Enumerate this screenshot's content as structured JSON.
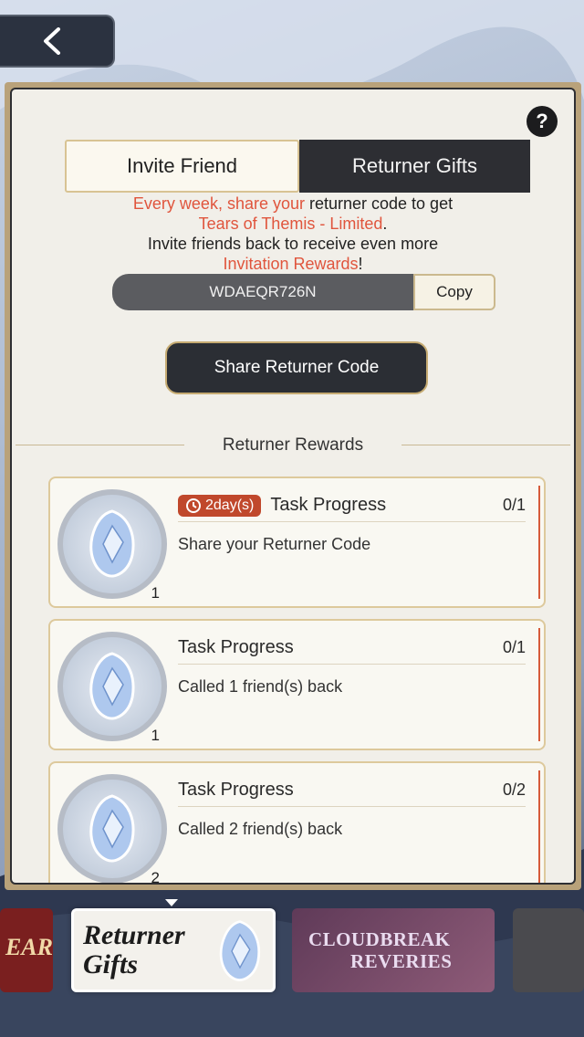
{
  "nav": {
    "back_icon": "chevron-left-icon"
  },
  "help": {
    "label": "?"
  },
  "tabs": [
    {
      "label": "Invite Friend",
      "active": true
    },
    {
      "label": "Returner Gifts",
      "active": false
    }
  ],
  "intro": {
    "line1_a": "Every week, share your",
    "line1_b": " returner code to get",
    "line2_a": "Tears of Themis - Limited",
    "line2_b": ".",
    "line3": "Invite friends back to receive even more",
    "line4_a": "Invitation Rewards",
    "line4_b": "!"
  },
  "code": {
    "value": "WDAEQR726N",
    "copy_label": "Copy"
  },
  "share_button": "Share Returner Code",
  "section_title": "Returner Rewards",
  "tasks": [
    {
      "timer": "2day(s)",
      "title": "Task Progress",
      "progress": "0/1",
      "desc": "Share your Returner Code",
      "reward_count": "1"
    },
    {
      "timer": "",
      "title": "Task Progress",
      "progress": "0/1",
      "desc": "Called 1 friend(s) back",
      "reward_count": "1"
    },
    {
      "timer": "",
      "title": "Task Progress",
      "progress": "0/2",
      "desc": "Called 2 friend(s) back",
      "reward_count": "2"
    }
  ],
  "bottom_banners": {
    "left_partial": "EAR",
    "active_line1": "Returner",
    "active_line2": "Gifts",
    "cloud_line1": "CLOUDBREAK",
    "cloud_line2": "REVERIES"
  },
  "colors": {
    "accent_red": "#e0553d",
    "timer_bg": "#c0482c",
    "dark_tab": "#2d2e33",
    "gold_border": "#ddc99c"
  }
}
